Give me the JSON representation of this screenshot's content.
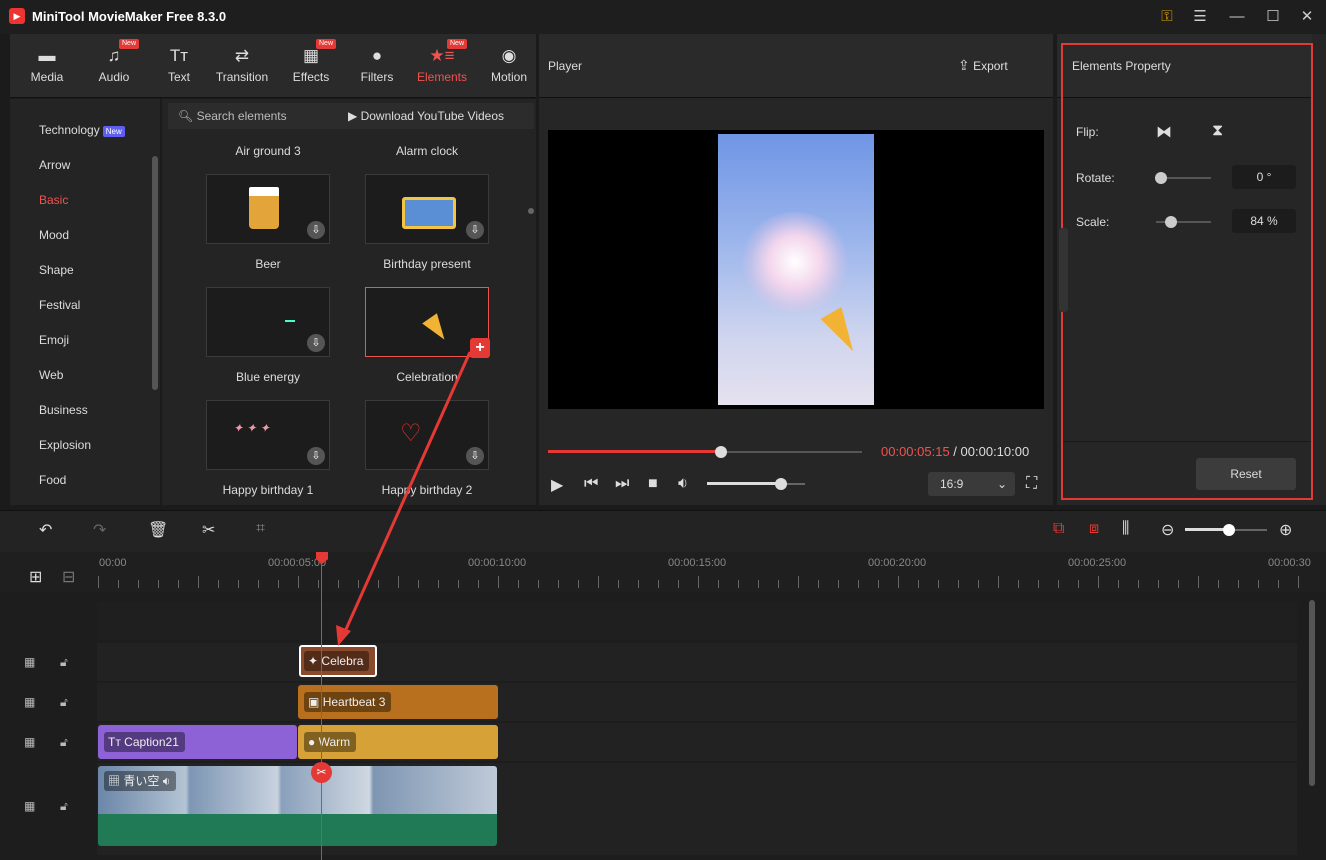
{
  "app": {
    "title": "MiniTool MovieMaker Free 8.3.0"
  },
  "nav": {
    "items": [
      {
        "label": "Media",
        "icon": "folder-icon"
      },
      {
        "label": "Audio",
        "icon": "music-note-icon",
        "badge": "New"
      },
      {
        "label": "Text",
        "icon": "text-icon"
      },
      {
        "label": "Transition",
        "icon": "transition-icon"
      },
      {
        "label": "Effects",
        "icon": "effects-icon",
        "badge": "New"
      },
      {
        "label": "Filters",
        "icon": "filters-icon"
      },
      {
        "label": "Elements",
        "icon": "elements-icon",
        "badge": "New"
      },
      {
        "label": "Motion",
        "icon": "motion-icon"
      }
    ],
    "active": "Elements"
  },
  "categories": {
    "items": [
      "Technology",
      "Arrow",
      "Basic",
      "Mood",
      "Shape",
      "Festival",
      "Emoji",
      "Web",
      "Business",
      "Explosion",
      "Food"
    ],
    "active": "Basic",
    "technology_badge": "New"
  },
  "library": {
    "search_label": "Search elements",
    "download_label": "Download YouTube Videos",
    "top_labels": [
      "Air ground 3",
      "Alarm clock"
    ],
    "items": [
      "Beer",
      "Birthday present",
      "Blue energy",
      "Celebration",
      "Happy birthday 1",
      "Happy birthday 2"
    ],
    "selected": "Celebration"
  },
  "player": {
    "title": "Player",
    "export_label": "Export",
    "current_time": "00:00:05:15",
    "separator": " / ",
    "total_time": "00:00:10:00",
    "progress": 0.55,
    "volume": 0.75,
    "aspect": "16:9"
  },
  "properties": {
    "title": "Elements Property",
    "flip_label": "Flip:",
    "rotate_label": "Rotate:",
    "rotate_value": "0 °",
    "scale_label": "Scale:",
    "scale_value": "84 %",
    "reset_label": "Reset"
  },
  "timeline": {
    "ruler": [
      "00:00",
      "00:00:05:00",
      "00:00:10:00",
      "00:00:15:00",
      "00:00:20:00",
      "00:00:25:00",
      "00:00:30"
    ],
    "clips": {
      "element": "Celebra",
      "effect": "Heartbeat 3",
      "caption": "Caption21",
      "filter": "Warm",
      "video": "青い空"
    }
  },
  "colors": {
    "accent": "#ef5350",
    "element_clip": "#8b4a2b",
    "effect_clip": "#b8701f",
    "caption_clip": "#8c62d6",
    "filter_clip": "#d6a237",
    "audio_clip": "#1f7a55"
  }
}
